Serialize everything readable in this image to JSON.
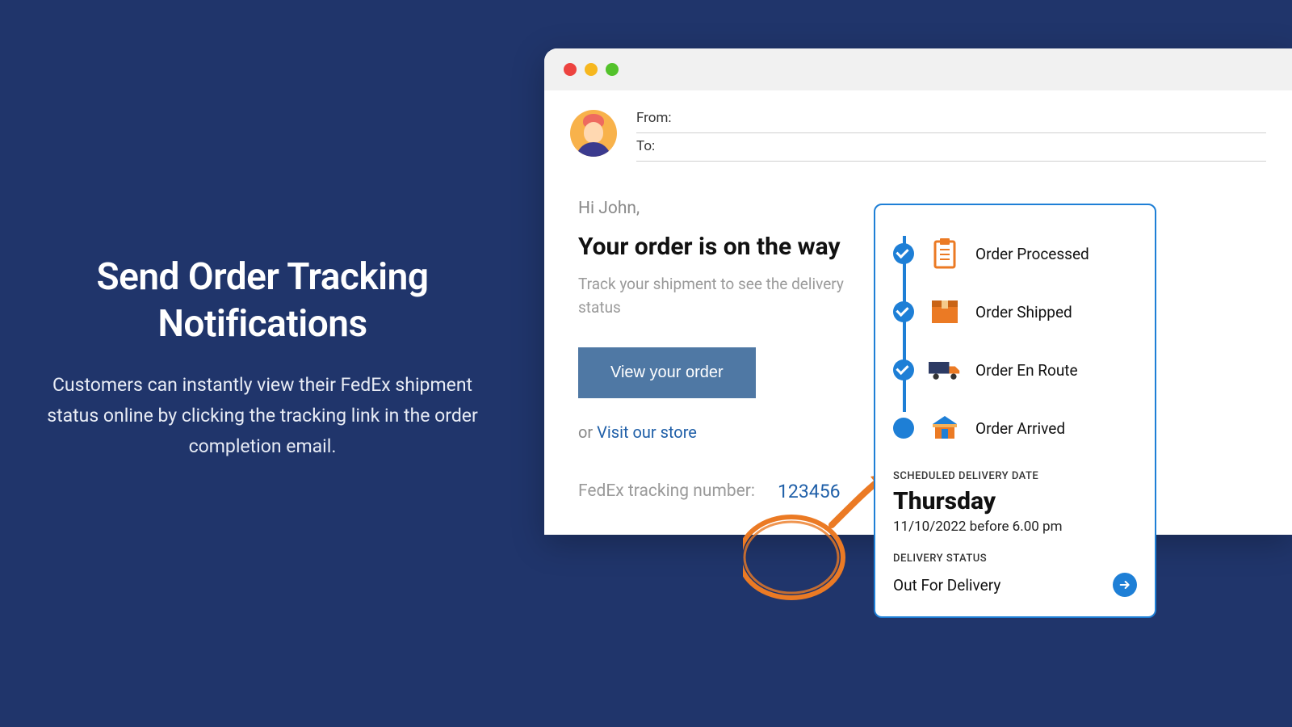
{
  "headline": {
    "title": "Send Order Tracking Notifications",
    "description": "Customers can instantly view their FedEx shipment status online by clicking the tracking link in the order completion email."
  },
  "email": {
    "from_label": "From:",
    "to_label": "To:",
    "greeting": "Hi John,",
    "headline": "Your order is on the way",
    "subtext": "Track your shipment to see the delivery status",
    "cta_label": "View your order",
    "or_prefix": "or ",
    "visit_store_label": "Visit our store",
    "tracking_label": "FedEx tracking number:",
    "tracking_number": "123456"
  },
  "tracking": {
    "steps": [
      {
        "label": "Order Processed",
        "done": true,
        "icon": "clipboard"
      },
      {
        "label": "Order Shipped",
        "done": true,
        "icon": "box"
      },
      {
        "label": "Order En Route",
        "done": true,
        "icon": "truck"
      },
      {
        "label": "Order Arrived",
        "done": false,
        "icon": "store"
      }
    ],
    "scheduled_label": "SCHEDULED DELIVERY DATE",
    "day": "Thursday",
    "datetime": "11/10/2022 before 6.00 pm",
    "status_label": "DELIVERY STATUS",
    "status_value": "Out For Delivery"
  },
  "colors": {
    "bg": "#20356b",
    "accent_blue": "#1e7fd6",
    "accent_orange": "#eb7a24",
    "button": "#4f78a4"
  }
}
